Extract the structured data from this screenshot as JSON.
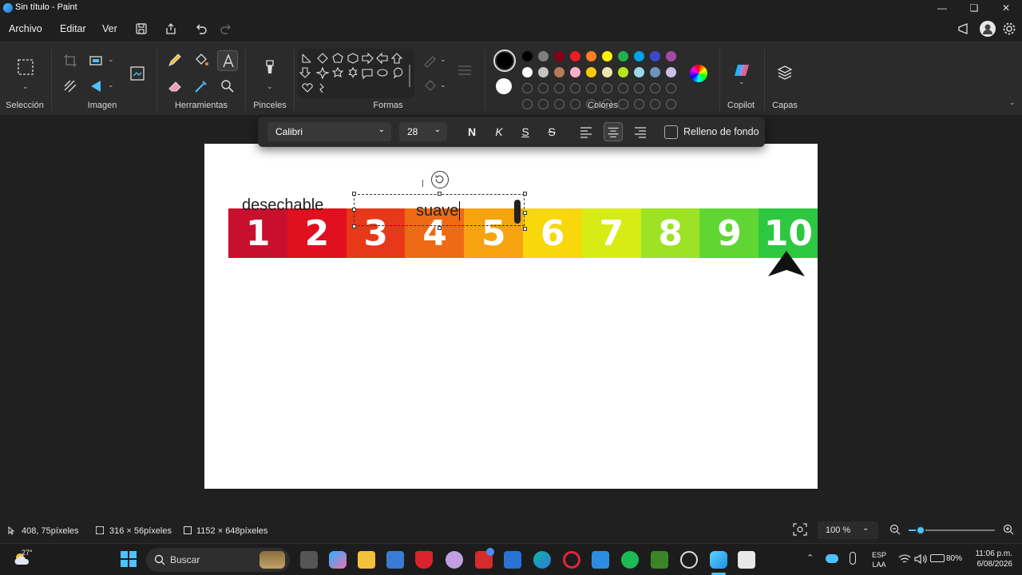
{
  "window": {
    "title": "Sin título - Paint"
  },
  "menu": {
    "file": "Archivo",
    "edit": "Editar",
    "view": "Ver"
  },
  "ribbon": {
    "groups": {
      "selection": "Selección",
      "image": "Imagen",
      "tools": "Herramientas",
      "brushes": "Pinceles",
      "shapes": "Formas",
      "colors": "Colores",
      "copilot": "Copilot",
      "layers": "Capas"
    },
    "colors": {
      "primary": "#000000",
      "secondary": "#ffffff",
      "row1": [
        "#000000",
        "#7f7f7f",
        "#880015",
        "#ed1c24",
        "#ff7f27",
        "#fff200",
        "#22b14c",
        "#00a2e8",
        "#3f48cc",
        "#a349a4"
      ],
      "row2": [
        "#ffffff",
        "#c3c3c3",
        "#b97a57",
        "#ffaec9",
        "#ffc90e",
        "#efe4b0",
        "#b5e61d",
        "#99d9ea",
        "#7092be",
        "#c8bfe7"
      ]
    }
  },
  "textbar": {
    "font": "Calibri",
    "size": "28",
    "bold": "N",
    "italic": "K",
    "underline": "S",
    "strike": "S",
    "fill_label": "Relleno de fondo"
  },
  "canvas": {
    "scale": {
      "numbers": [
        "1",
        "2",
        "3",
        "4",
        "5",
        "6",
        "7",
        "8",
        "9",
        "10"
      ],
      "colors": [
        "#c8102e",
        "#e0101f",
        "#e8381a",
        "#ef6a14",
        "#f5a30f",
        "#f8d80a",
        "#d6ec14",
        "#9ee225",
        "#5fd633",
        "#2ec840"
      ]
    },
    "label_left": "desechable",
    "label_editing": "suave"
  },
  "status": {
    "cursor": "408, 75píxeles",
    "selection": "316 × 56píxeles",
    "canvas_size": "1152 × 648píxeles",
    "zoom": "100 %"
  },
  "taskbar": {
    "weather": "27°",
    "search": "Buscar",
    "lang1": "ESP",
    "lang2": "LAA",
    "battery": "80%",
    "time": "11:06 p.m.",
    "date": "6/08/2026"
  }
}
